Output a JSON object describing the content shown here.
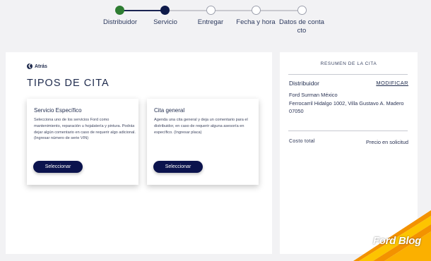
{
  "stepper": {
    "steps": [
      {
        "label": "Distribuidor",
        "state": "completed"
      },
      {
        "label": "Servicio",
        "state": "current"
      },
      {
        "label": "Entregar",
        "state": "pending"
      },
      {
        "label": "Fecha y hora",
        "state": "pending"
      },
      {
        "label": "Datos de conta cto",
        "state": "pending"
      }
    ]
  },
  "main": {
    "back_label": "Atrás",
    "title": "TIPOS DE CITA",
    "options": [
      {
        "title": "Servicio Específico",
        "description": "Selecciona uno de los servicios Ford como mantenimiento, reparación u hojalatería y pintura. Podrás dejar algún comentario en caso de requerir algo adicional. (Ingresar número de serie VIN)",
        "button_label": "Seleccionar"
      },
      {
        "title": "Cita general",
        "description": "Agenda una cita general y deja un comentario para el distribuidor, en caso de requerir alguna asesoría en específico. (Ingresar placa)",
        "button_label": "Seleccionar"
      }
    ]
  },
  "summary": {
    "title": "RESUMEN DE LA CITA",
    "dealer_label": "Distribuidor",
    "modify_label": "MODIFICAR",
    "dealer_name": "Ford Surman México",
    "dealer_address": "Ferrocarril Hidalgo 1002, Villa Gustavo A. Madero",
    "dealer_zip": "07050",
    "cost_label": "Costo total",
    "cost_value": "Precio en solicitud"
  },
  "watermark": {
    "text": "Ford Blog"
  },
  "colors": {
    "completed": "#2e7d32",
    "current": "#0e1a4a",
    "button": "#0b134d",
    "stripe_orange": "#f39200",
    "stripe_yellow": "#fdc400"
  }
}
